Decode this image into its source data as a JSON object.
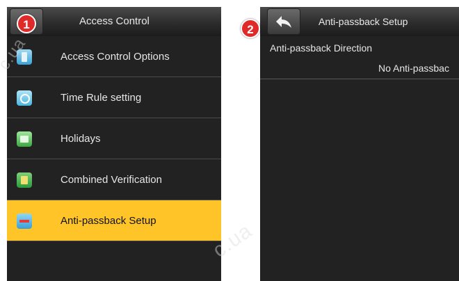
{
  "left_screen": {
    "title": "Access Control",
    "menu": [
      {
        "label": "Access Control Options",
        "icon": "access-control-icon",
        "selected": false
      },
      {
        "label": "Time Rule setting",
        "icon": "clock-icon",
        "selected": false
      },
      {
        "label": "Holidays",
        "icon": "calendar-icon",
        "selected": false
      },
      {
        "label": "Combined Verification",
        "icon": "combined-verification-icon",
        "selected": false
      },
      {
        "label": "Anti-passback Setup",
        "icon": "anti-passback-icon",
        "selected": true
      }
    ]
  },
  "right_screen": {
    "title": "Anti-passback Setup",
    "direction_label": "Anti-passback Direction",
    "direction_value": "No Anti-passbac"
  },
  "badges": {
    "step1": "1",
    "step2": "2"
  },
  "watermarks": {
    "a": "c.ua",
    "b": "c.ua"
  },
  "colors": {
    "selected_bg": "#ffc428",
    "screen_bg": "#222222",
    "badge": "#e02a2a"
  }
}
